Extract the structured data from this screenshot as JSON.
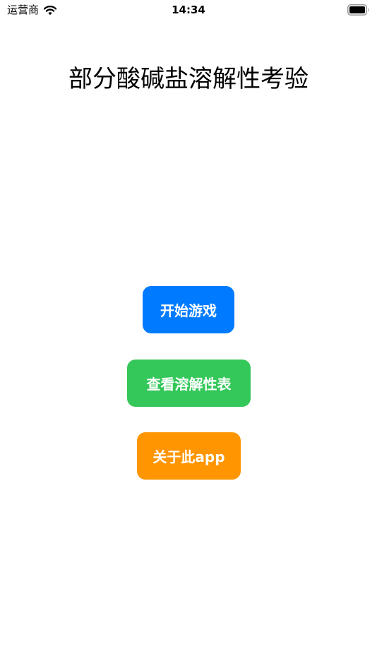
{
  "status_bar": {
    "carrier": "运营商",
    "time": "14:34",
    "wifi_icon": "wifi-icon",
    "battery_icon": "battery-icon"
  },
  "main": {
    "title": "部分酸碱盐溶解性考验",
    "buttons": {
      "start": {
        "label": "开始游戏",
        "color": "#007aff"
      },
      "solubility_table": {
        "label": "查看溶解性表",
        "color": "#34c759"
      },
      "about": {
        "label": "关于此app",
        "color": "#ff9500"
      }
    }
  }
}
